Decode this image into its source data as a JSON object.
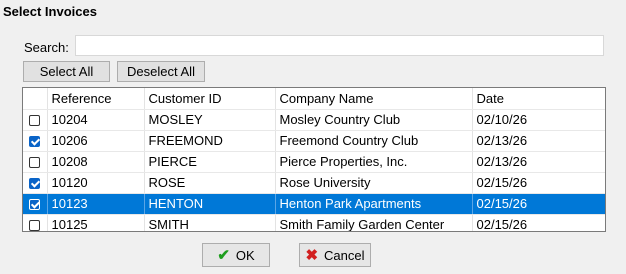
{
  "window": {
    "title": "Select Invoices"
  },
  "search": {
    "label": "Search:",
    "value": "",
    "placeholder": ""
  },
  "buttons": {
    "select_all": "Select All",
    "deselect_all": "Deselect All",
    "ok": "OK",
    "cancel": "Cancel",
    "ok_icon": "checkmark-icon",
    "cancel_icon": "x-icon"
  },
  "table": {
    "columns": [
      "",
      "Reference",
      "Customer ID",
      "Company Name",
      "Date"
    ],
    "rows": [
      {
        "checked": false,
        "selected": false,
        "reference": "10204",
        "customer_id": "MOSLEY",
        "company": "Mosley Country Club",
        "date": "02/10/26"
      },
      {
        "checked": true,
        "selected": false,
        "reference": "10206",
        "customer_id": "FREEMOND",
        "company": "Freemond Country Club",
        "date": "02/13/26"
      },
      {
        "checked": false,
        "selected": false,
        "reference": "10208",
        "customer_id": "PIERCE",
        "company": "Pierce Properties, Inc.",
        "date": "02/13/26"
      },
      {
        "checked": true,
        "selected": false,
        "reference": "10120",
        "customer_id": "ROSE",
        "company": "Rose University",
        "date": "02/15/26"
      },
      {
        "checked": true,
        "selected": true,
        "reference": "10123",
        "customer_id": "HENTON",
        "company": "Henton Park Apartments",
        "date": "02/15/26"
      },
      {
        "checked": false,
        "selected": false,
        "reference": "10125",
        "customer_id": "SMITH",
        "company": "Smith Family Garden Center",
        "date": "02/15/26"
      }
    ]
  },
  "colors": {
    "selection": "#0078d7",
    "check": "#0a64c8",
    "ok_icon": "#1e9e1e",
    "cancel_icon": "#d22020"
  }
}
